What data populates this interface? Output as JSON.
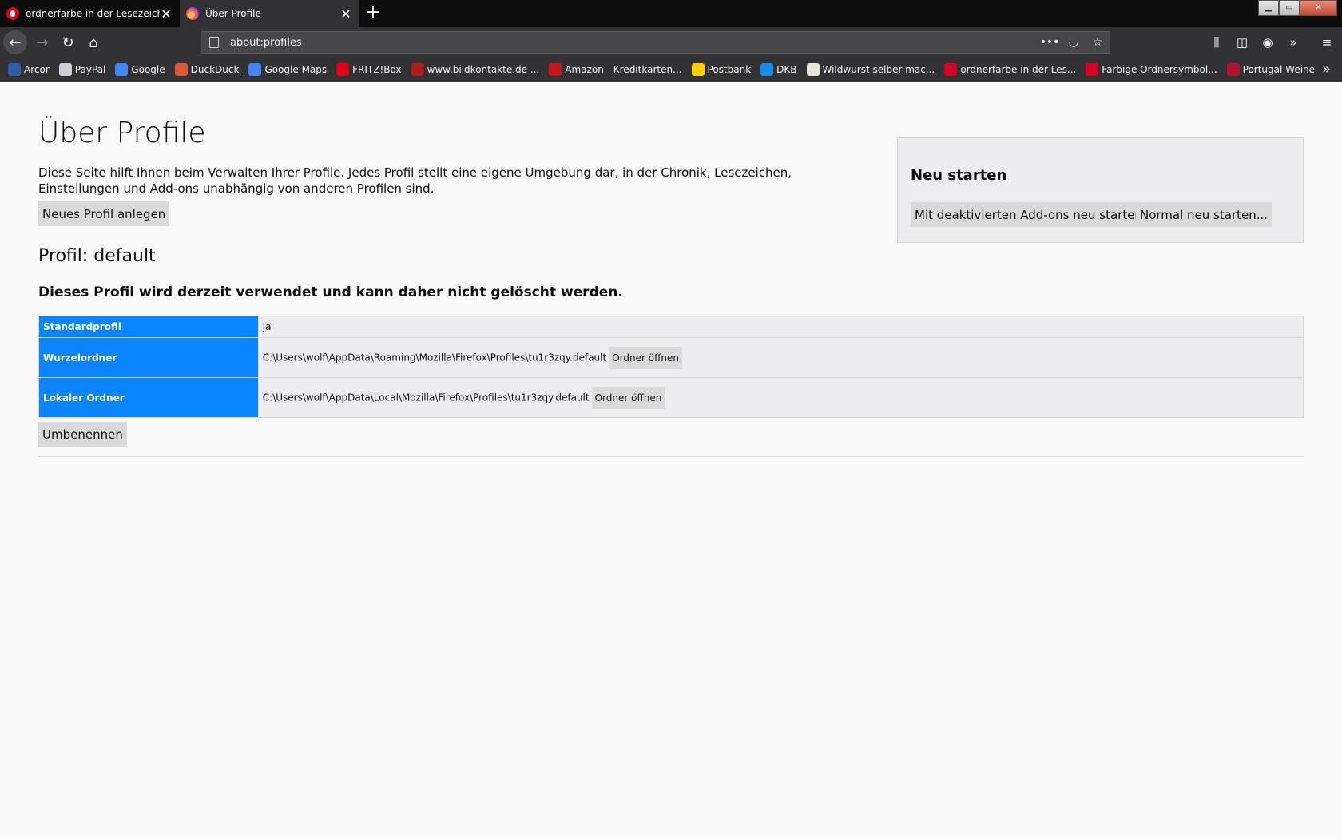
{
  "tabs": [
    {
      "label": "ordnerfarbe in der Lesezeichen",
      "close": "✕"
    },
    {
      "label": "Über Profile",
      "close": "✕"
    }
  ],
  "newtab": "+",
  "window_controls": {
    "minimize": "▁",
    "maximize": "▭",
    "close": "✕"
  },
  "nav": {
    "back": "←",
    "forward": "→",
    "reload": "↻",
    "home": "⌂"
  },
  "urlbar": {
    "url": "about:profiles",
    "more": "•••",
    "pocket": "◡",
    "star": "☆"
  },
  "toolbar_right": {
    "library": "⫼",
    "sidebar": "◫",
    "account": "◉",
    "overflow": "»",
    "menu": "≡"
  },
  "bookmarks": [
    {
      "label": "Arcor",
      "color": "#2b5da8"
    },
    {
      "label": "PayPal",
      "color": "#cfcfd8"
    },
    {
      "label": "Google",
      "color": "#4285f4"
    },
    {
      "label": "DuckDuck",
      "color": "#de5833"
    },
    {
      "label": "Google Maps",
      "color": "#4285f4"
    },
    {
      "label": "FRITZ!Box",
      "color": "#e2001a"
    },
    {
      "label": "www.bildkontakte.de ...",
      "color": "#b01c1c"
    },
    {
      "label": "Amazon - Kreditkarten...",
      "color": "#c4161c"
    },
    {
      "label": "Postbank",
      "color": "#ffcc00"
    },
    {
      "label": "DKB",
      "color": "#148dea"
    },
    {
      "label": "Wildwurst selber mac...",
      "color": "#e8e4d8"
    },
    {
      "label": "ordnerfarbe in der Les...",
      "color": "#d70022"
    },
    {
      "label": "Farbige Ordnersymbol...",
      "color": "#d70022"
    },
    {
      "label": "Portugal Weine",
      "color": "#b3122e"
    }
  ],
  "bookmarks_overflow": "»",
  "page": {
    "title": "Über Profile",
    "intro": "Diese Seite hilft Ihnen beim Verwalten Ihrer Profile. Jedes Profil stellt eine eigene Umgebung dar, in der Chronik, Lesezeichen, Einstellungen und Add-ons unabhängig von anderen Profilen sind.",
    "new_profile_button": "Neues Profil anlegen",
    "restart": {
      "title": "Neu starten",
      "addons_button": "Mit deaktivierten Add-ons neu starten...",
      "normal_button": "Normal neu starten..."
    },
    "profile": {
      "name": "Profil: default",
      "note": "Dieses Profil wird derzeit verwendet und kann daher nicht gelöscht werden.",
      "rows": [
        {
          "label": "Standardprofil",
          "value": "ja"
        },
        {
          "label": "Wurzelordner",
          "value": "C:\\Users\\wolf\\AppData\\Roaming\\Mozilla\\Firefox\\Profiles\\tu1r3zqy.default",
          "button": "Ordner öffnen"
        },
        {
          "label": "Lokaler Ordner",
          "value": "C:\\Users\\wolf\\AppData\\Local\\Mozilla\\Firefox\\Profiles\\tu1r3zqy.default",
          "button": "Ordner öffnen"
        }
      ],
      "rename_button": "Umbenennen"
    }
  },
  "colors": {
    "accent": "#0a84ff",
    "chrome_dark": "#323234",
    "tabstrip": "#0c0c0d"
  }
}
